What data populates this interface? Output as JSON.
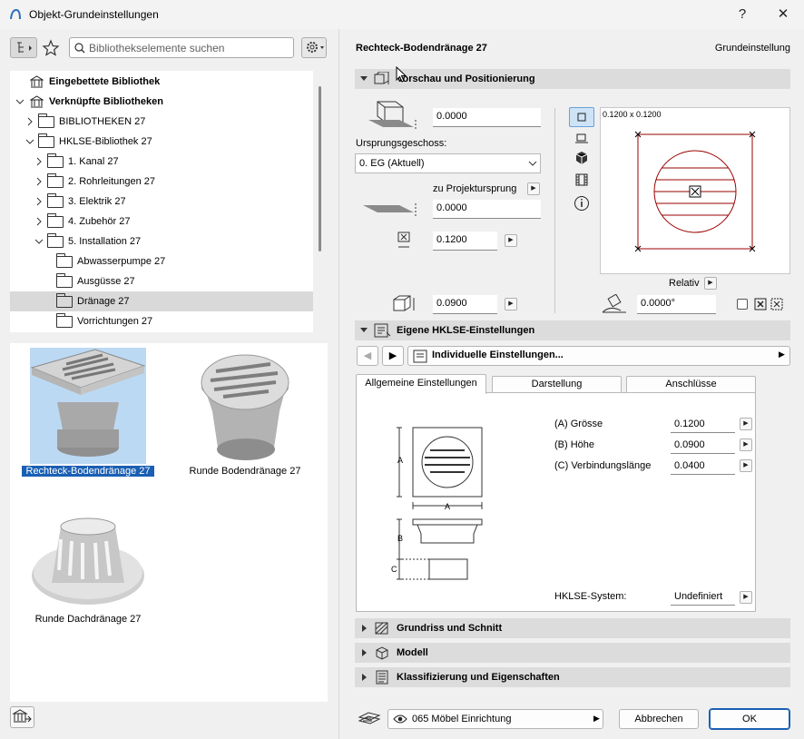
{
  "window": {
    "title": "Objekt-Grundeinstellungen",
    "help_label": "?",
    "close_label": "✕"
  },
  "search": {
    "placeholder": "Bibliothekselemente suchen"
  },
  "tree": {
    "items": [
      {
        "label": "Eingebettete Bibliothek"
      },
      {
        "label": "Verknüpfte Bibliotheken"
      },
      {
        "label": "BIBLIOTHEKEN 27"
      },
      {
        "label": "HKLSE-Bibliothek 27"
      },
      {
        "label": "1. Kanal 27"
      },
      {
        "label": "2. Rohrleitungen 27"
      },
      {
        "label": "3. Elektrik 27"
      },
      {
        "label": "4. Zubehör 27"
      },
      {
        "label": "5. Installation 27"
      },
      {
        "label": "Abwasserpumpe 27"
      },
      {
        "label": "Ausgüsse 27"
      },
      {
        "label": "Dränage 27"
      },
      {
        "label": "Vorrichtungen 27"
      }
    ]
  },
  "gallery": {
    "items": [
      {
        "label": "Rechteck-Bodendränage 27"
      },
      {
        "label": "Runde Bodendränage 27"
      },
      {
        "label": "Runde Dachdränage 27"
      }
    ]
  },
  "header": {
    "object_name": "Rechteck-Bodendränage 27",
    "mode": "Grundeinstellung"
  },
  "preview_section": {
    "title": "Vorschau und Positionierung",
    "elevation": "0.0000",
    "story_label": "Ursprungsgeschoss:",
    "story_value": "0. EG (Aktuell)",
    "project_origin_label": "zu Projektursprung",
    "origin_value": "0.0000",
    "width": "0.1200",
    "height": "0.0900",
    "preview_size": "0.1200 x 0.1200",
    "relative_label": "Relativ",
    "angle": "0.0000°"
  },
  "hklse_section": {
    "title": "Eigene HKLSE-Einstellungen",
    "page_selector": "Individuelle Einstellungen...",
    "tabs": [
      {
        "label": "Allgemeine Einstellungen"
      },
      {
        "label": "Darstellung"
      },
      {
        "label": "Anschlüsse"
      }
    ],
    "params": [
      {
        "label": "(A) Grösse",
        "value": "0.1200"
      },
      {
        "label": "(B) Höhe",
        "value": "0.0900"
      },
      {
        "label": "(C) Verbindungslänge",
        "value": "0.0400"
      }
    ],
    "system_label": "HKLSE-System:",
    "system_value": "Undefiniert",
    "dim_A": "A",
    "dim_B": "B",
    "dim_C": "C"
  },
  "collapsed_sections": [
    {
      "title": "Grundriss und Schnitt"
    },
    {
      "title": "Modell"
    },
    {
      "title": "Klassifizierung und Eigenschaften"
    }
  ],
  "footer": {
    "layer": "065 Möbel Einrichtung",
    "cancel_label": "Abbrechen",
    "ok_label": "OK"
  }
}
